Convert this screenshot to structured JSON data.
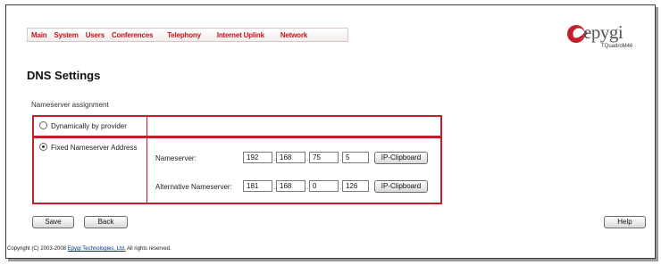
{
  "nav": {
    "items": [
      "Main",
      "System",
      "Users",
      "Conferences",
      "Telephony",
      "Internet Uplink",
      "Network"
    ]
  },
  "brand": {
    "logo_text": "epygi",
    "model": "TQuadroM46"
  },
  "page": {
    "title": "DNS Settings",
    "section_label": "Nameserver assignment"
  },
  "options": {
    "dynamic_label": "Dynamically by provider",
    "dynamic_selected": false,
    "fixed_label": "Fixed Nameserver Address",
    "fixed_selected": true
  },
  "nameserver": {
    "label": "Nameserver:",
    "octets": [
      "192",
      "168",
      "75",
      "5"
    ],
    "clipboard_label": "IP-Clipboard"
  },
  "alt_nameserver": {
    "label": "Alternative Nameserver:",
    "octets": [
      "181",
      "168",
      "0",
      "126"
    ],
    "clipboard_label": "IP-Clipboard"
  },
  "buttons": {
    "save": "Save",
    "back": "Back",
    "help": "Help"
  },
  "footer": {
    "prefix": "Copyright (C) 2003-2008 ",
    "company": "Epygi Technologies, Ltd.",
    "suffix": " All rights reserved."
  },
  "colors": {
    "accent": "#c41f2a",
    "nav_text": "#c4151c"
  }
}
